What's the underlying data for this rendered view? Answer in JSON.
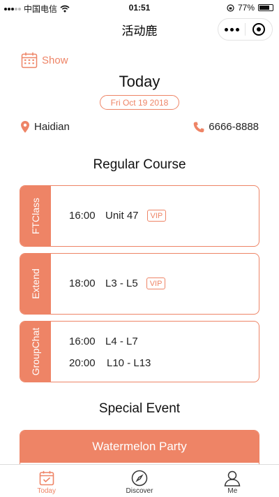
{
  "status_bar": {
    "carrier": "中国电信",
    "time": "01:51",
    "battery": "77%",
    "battery_level": 0.77
  },
  "nav": {
    "title": "活动鹿"
  },
  "header": {
    "show_label": "Show",
    "today_title": "Today",
    "date": "Fri Oct 19 2018"
  },
  "info": {
    "location": "Haidian",
    "phone": "6666-8888"
  },
  "regular": {
    "title": "Regular Course",
    "courses": [
      {
        "tag": "FTClass",
        "rows": [
          {
            "time": "16:00",
            "lesson": "Unit 47",
            "badge": "VIP"
          }
        ]
      },
      {
        "tag": "Extend",
        "rows": [
          {
            "time": "18:00",
            "lesson": "L3 - L5",
            "badge": "VIP"
          }
        ]
      },
      {
        "tag": "GroupChat",
        "rows": [
          {
            "time": "16:00",
            "lesson": "L4 - L7"
          },
          {
            "time": "20:00",
            "lesson": "L10 - L13"
          }
        ]
      }
    ]
  },
  "special": {
    "title": "Special Event",
    "events": [
      {
        "name": "Watermelon Party"
      }
    ]
  },
  "tab_bar": {
    "tabs": [
      {
        "label": "Today",
        "icon": "calendar-icon",
        "active": true
      },
      {
        "label": "Discover",
        "icon": "compass-icon"
      },
      {
        "label": "Me",
        "icon": "person-icon"
      }
    ]
  },
  "colors": {
    "accent": "#ee8466"
  }
}
